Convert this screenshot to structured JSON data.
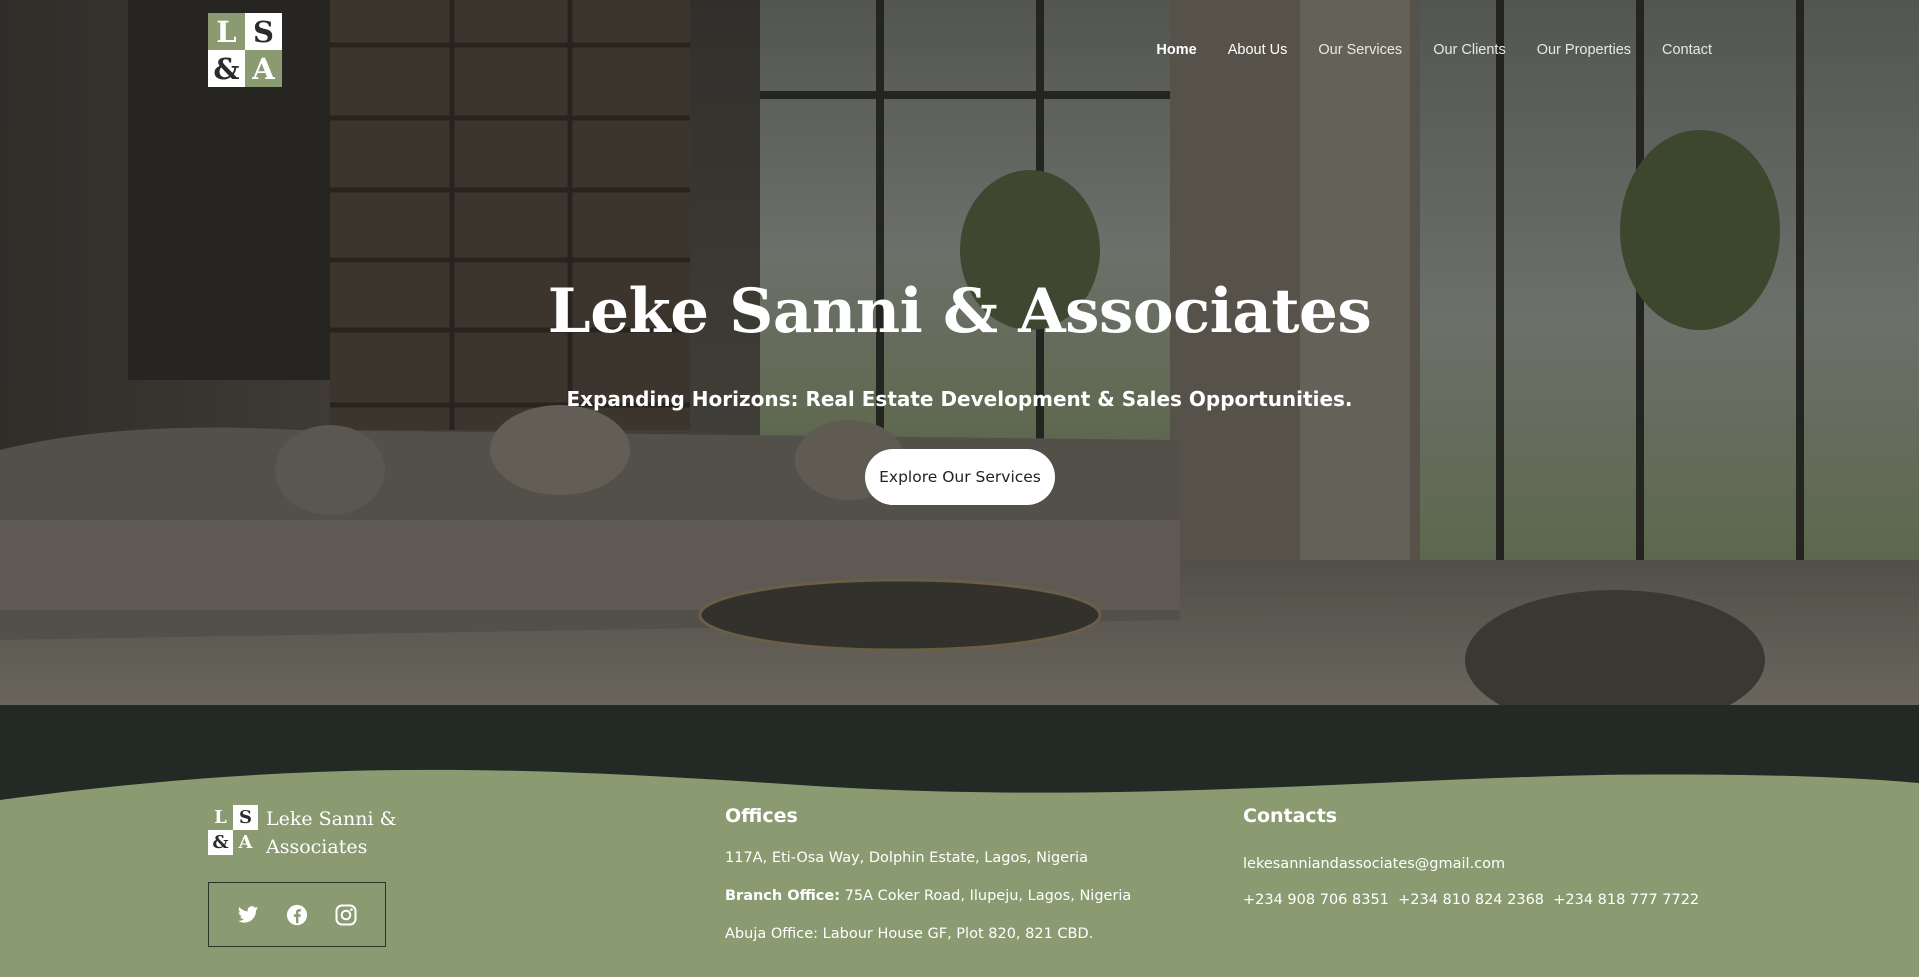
{
  "brand": {
    "logo_letters": [
      "L",
      "S",
      "&",
      "A"
    ],
    "name_line1": "Leke Sanni &",
    "name_line2": "Associates"
  },
  "nav": {
    "items": [
      {
        "label": "Home"
      },
      {
        "label": "About Us"
      },
      {
        "label": "Our Services"
      },
      {
        "label": "Our Clients"
      },
      {
        "label": "Our Properties"
      },
      {
        "label": "Contact"
      }
    ]
  },
  "hero": {
    "title": "Leke Sanni & Associates",
    "subtitle": "Expanding Horizons: Real Estate Development & Sales Opportunities.",
    "cta_label": "Explore Our Services"
  },
  "footer": {
    "offices": {
      "title": "Offices",
      "address1": "117A, Eti-Osa Way, Dolphin Estate, Lagos, Nigeria",
      "branch_label": "Branch Office:",
      "branch_address": " 75A Coker Road, Ilupeju, Lagos, Nigeria",
      "abuja": "Abuja Office: Labour House GF, Plot 820, 821 CBD."
    },
    "contacts": {
      "title": "Contacts",
      "email": "lekesanniandassociates@gmail.com",
      "phones": "+234 908 706 8351  +234 810 824 2368  +234 818 777 7722"
    },
    "social": [
      {
        "icon": "twitter-icon"
      },
      {
        "icon": "facebook-icon"
      },
      {
        "icon": "instagram-icon"
      }
    ]
  },
  "colors": {
    "accent_green": "#8a9b72",
    "dark_band": "#232a25",
    "white": "#ffffff"
  }
}
